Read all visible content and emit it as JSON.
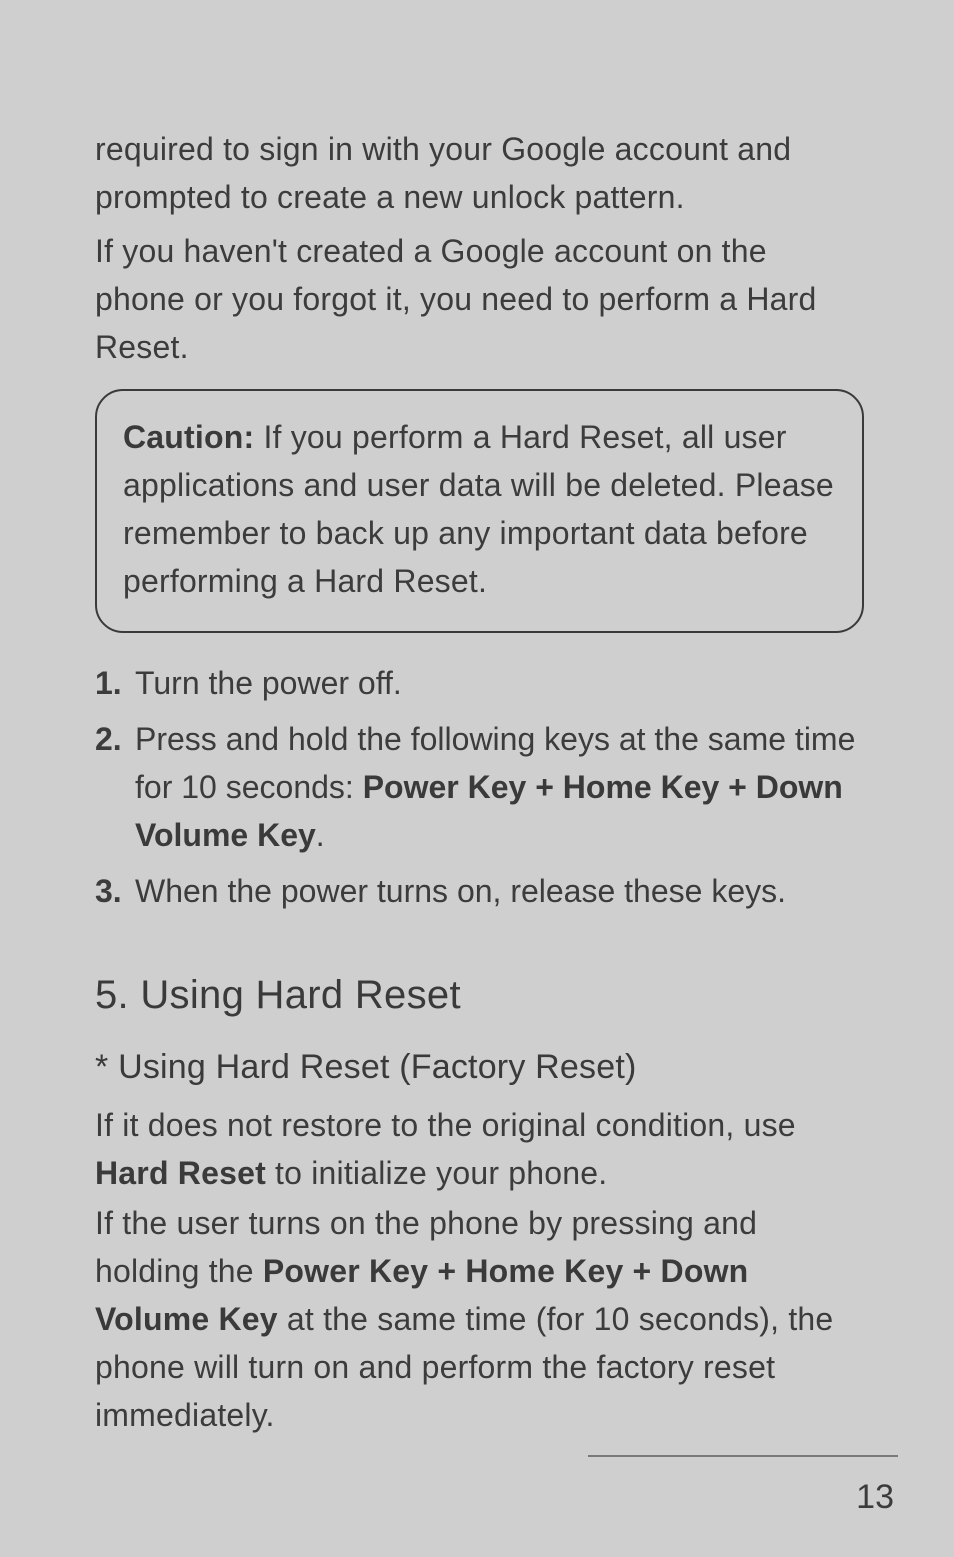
{
  "intro": {
    "p1": "required to sign in with your Google account and prompted to create a new unlock pattern.",
    "p2": "If you haven't created a Google account on the phone or you forgot it, you need to perform a Hard Reset."
  },
  "caution": {
    "label": "Caution:",
    "text": " If you perform a Hard Reset, all user applications and user data will be deleted. Please remember to back up any important data before performing a Hard Reset."
  },
  "steps": {
    "s1": {
      "num": "1.",
      "text": " Turn the power off."
    },
    "s2": {
      "num": "2.",
      "pre": "Press and hold the following keys at the same time for 10 seconds: ",
      "bold": "Power Key + Home Key + Down Volume Key",
      "post": "."
    },
    "s3": {
      "num": "3.",
      "text": "When the power turns on, release these keys."
    }
  },
  "section5": {
    "heading": "5. Using Hard Reset",
    "subheading": "* Using Hard Reset (Factory Reset)",
    "p1_pre": "If it does not restore to the original condition, use ",
    "p1_bold": "Hard Reset",
    "p1_post": " to initialize your phone.",
    "p2_pre": "If the user turns on the phone by pressing and holding the ",
    "p2_bold": "Power Key + Home Key + Down Volume Key",
    "p2_post": " at the same time (for 10 seconds), the phone will turn on and perform the factory reset immediately."
  },
  "page_number": "13"
}
